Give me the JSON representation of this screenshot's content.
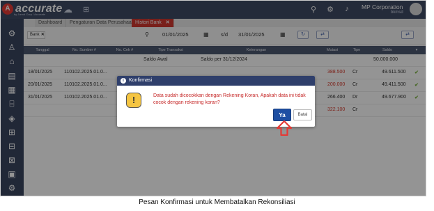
{
  "app": {
    "logo_text": "accurate",
    "logo_sub": "by Jurnal Corp / Accurate",
    "company_name": "MP Corporation",
    "company_user": "bkmsd"
  },
  "icons": {
    "logo": "accurate-logo-icon",
    "cloud": "cloud-icon",
    "menu": "menu-grid-icon",
    "search": "search-icon",
    "settings": "gear-icon",
    "notifications": "bell-icon",
    "avatar": "user-avatar"
  },
  "sidebar": {
    "items": [
      {
        "icon": "gear-icon",
        "glyph": "⚙"
      },
      {
        "icon": "people-icon",
        "glyph": "♙"
      },
      {
        "icon": "bank-icon",
        "glyph": "⌂"
      },
      {
        "icon": "document-icon",
        "glyph": "▤"
      },
      {
        "icon": "calculator-icon",
        "glyph": "▦"
      },
      {
        "icon": "building-icon",
        "glyph": "⌸"
      },
      {
        "icon": "tag-icon",
        "glyph": "◈"
      },
      {
        "icon": "cart-icon",
        "glyph": "⊞"
      },
      {
        "icon": "truck-icon",
        "glyph": "⊟"
      },
      {
        "icon": "factory-icon",
        "glyph": "⊠"
      },
      {
        "icon": "report-icon",
        "glyph": "▣"
      },
      {
        "icon": "settings-icon",
        "glyph": "⚙"
      }
    ]
  },
  "tabs": [
    {
      "label": "Dashboard"
    },
    {
      "label": "Pengaturan Data Perusahaan"
    },
    {
      "label": "Histori Bank"
    }
  ],
  "filter": {
    "account_chip": "Bank",
    "date_from": "01/01/2025",
    "date_separator": "s/d",
    "date_to": "31/01/2025"
  },
  "table": {
    "headers": [
      "Tanggal",
      "No. Sumber #",
      "No. Cek #",
      "Tipe Transaksi",
      "Keterangan",
      "Mutasi",
      "Tipe",
      "Saldo"
    ],
    "opening": {
      "label": "Saldo Awal",
      "note": "Saldo per 31/12/2024",
      "balance": "50.000.000"
    },
    "rows": [
      {
        "date": "18/01/2025",
        "source": "110102.2025.01.0...",
        "amount": "388.500",
        "type": "Cr",
        "balance": "49.611.500",
        "red": true
      },
      {
        "date": "20/01/2025",
        "source": "110102.2025.01.0...",
        "amount": "200.000",
        "type": "Cr",
        "balance": "49.411.500",
        "red": true
      },
      {
        "date": "31/01/2025",
        "source": "110102.2025.01.0...",
        "amount": "266.400",
        "type": "Dr",
        "balance": "49.677.900",
        "red": false
      },
      {
        "date": "",
        "source": "",
        "amount": "322.100",
        "type": "Cr",
        "balance": "",
        "red": true
      }
    ]
  },
  "dialog": {
    "title": "Konfirmasi",
    "message": "Data sudah dicocokkan dengan Rekening Koran, Apakah data ini tidak cocok dengan rekening koran?",
    "yes_label": "Ya",
    "cancel_label": "Batal"
  },
  "caption": "Pesan Konfirmasi untuk Membatalkan Rekonsiliasi",
  "colors": {
    "topbar": "#3f4a64",
    "active_tab": "#d1372f",
    "dialog_header": "#2f3f6b",
    "primary_button": "#1e4fa3",
    "warning": "#f5c542",
    "highlight_arrow": "#e53935"
  }
}
